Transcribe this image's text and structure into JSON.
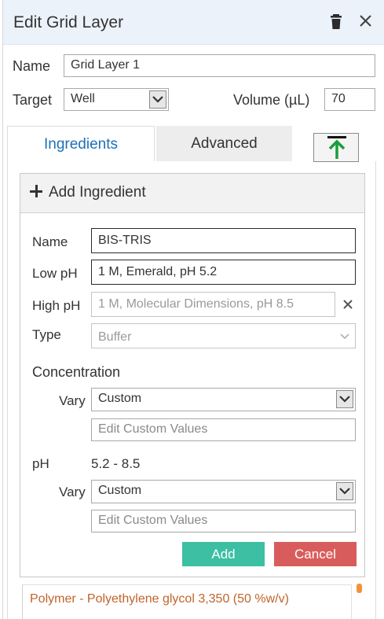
{
  "header": {
    "title": "Edit Grid Layer",
    "trash_icon": "trash-icon",
    "close_icon": "close-icon"
  },
  "layer": {
    "name_label": "Name",
    "name_value": "Grid Layer 1",
    "target_label": "Target",
    "target_value": "Well",
    "volume_label": "Volume (µL)",
    "volume_value": "70"
  },
  "tabs": [
    {
      "label": "Ingredients",
      "active": true
    },
    {
      "label": "Advanced",
      "active": false
    }
  ],
  "upload_icon": "arrow-up-to-line-icon",
  "ingredient": {
    "header": "Add Ingredient",
    "name_label": "Name",
    "name_value": "BIS-TRIS",
    "low_ph_label": "Low pH",
    "low_ph_value": "1 M, Emerald, pH 5.2",
    "high_ph_label": "High pH",
    "high_ph_value": "1 M, Molecular Dimensions, pH 8.5",
    "type_label": "Type",
    "type_value": "Buffer",
    "concentration_label": "Concentration",
    "conc_vary_label": "Vary",
    "conc_vary_value": "Custom",
    "conc_custom_placeholder": "Edit Custom Values",
    "ph_label": "pH",
    "ph_range": "5.2 - 8.5",
    "ph_vary_label": "Vary",
    "ph_vary_value": "Custom",
    "ph_custom_placeholder": "Edit Custom Values",
    "add_label": "Add",
    "cancel_label": "Cancel"
  },
  "list": {
    "item_1": "Polymer - Polyethylene glycol 3,350 (50 %w/v)"
  },
  "colors": {
    "header_bg": "#ecf2f9",
    "tab_active_text": "#1e6fb8",
    "add_button": "#3cbfa2",
    "cancel_button": "#d95c5c",
    "polymer_text": "#c0642a",
    "upload_arrow": "#1a9e3a"
  }
}
